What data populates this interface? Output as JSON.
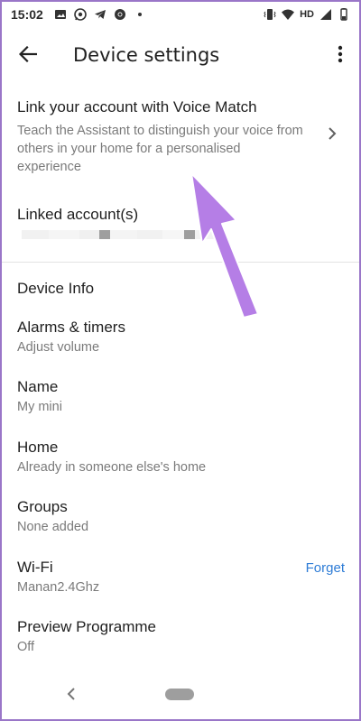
{
  "status_bar": {
    "time": "15:02",
    "network": "HD",
    "icons_left": [
      "image-icon",
      "whatsapp-icon",
      "telegram-icon",
      "chrome-icon",
      "dot-icon"
    ],
    "icons_right": [
      "vibrate-icon",
      "wifi-icon",
      "hd-icon",
      "signal-icon",
      "battery-icon"
    ]
  },
  "app_bar": {
    "title": "Device settings"
  },
  "voice_match": {
    "title": "Link your account with Voice Match",
    "description": "Teach the Assistant to distinguish your voice from others in your home for a personalised experience"
  },
  "linked_accounts": {
    "title": "Linked account(s)"
  },
  "device_info": {
    "header": "Device Info",
    "items": [
      {
        "label": "Alarms & timers",
        "sub": "Adjust volume"
      },
      {
        "label": "Name",
        "sub": "My mini"
      },
      {
        "label": "Home",
        "sub": "Already in someone else's home"
      },
      {
        "label": "Groups",
        "sub": "None added"
      },
      {
        "label": "Wi-Fi",
        "sub": "Manan2.4Ghz",
        "action": "Forget"
      },
      {
        "label": "Preview Programme",
        "sub": "Off"
      }
    ]
  },
  "colors": {
    "accent_link": "#2e7cd6",
    "annotation_arrow": "#b57ee6",
    "frame_border": "#9a76c8",
    "primary_text": "#212121",
    "secondary_text": "#7a7a7a"
  }
}
